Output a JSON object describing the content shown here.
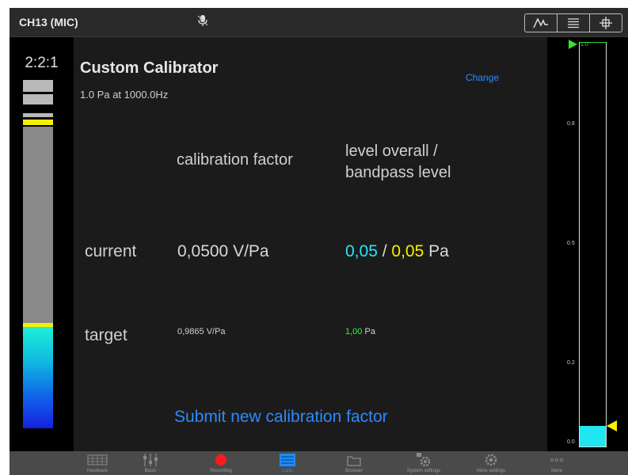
{
  "header": {
    "channel_title": "CH13 (MIC)",
    "mic_icon": "microphone-muted-icon",
    "view_toggle": [
      "waveform-icon",
      "list-icon",
      "crosshair-icon"
    ]
  },
  "left_meter": {
    "ratio": "2:2:1",
    "level_fraction": 0.34,
    "marker_fraction": 0.34
  },
  "calibrator": {
    "title": "Custom Calibrator",
    "subtitle": "1.0 Pa at 1000.0Hz",
    "change_label": "Change",
    "col_factor_header": "calibration factor",
    "col_level_header_line1": "level overall /",
    "col_level_header_line2": "bandpass level",
    "current_label": "current",
    "current_factor": "0,0500 V/Pa",
    "current_overall": "0,05",
    "current_sep": " / ",
    "current_bandpass": "0,05",
    "current_unit": " Pa",
    "target_label": "target",
    "target_factor": "0,9865 V/Pa",
    "target_level_value": "1,00",
    "target_level_unit": " Pa",
    "submit_label": "Submit new calibration factor"
  },
  "right_scale": {
    "ticks": [
      {
        "label": "1.0",
        "value": 1.0
      },
      {
        "label": "0.8",
        "value": 0.8
      },
      {
        "label": "0.5",
        "value": 0.5
      },
      {
        "label": "0.2",
        "value": 0.2
      },
      {
        "label": "0.0",
        "value": 0.0
      }
    ],
    "fill_value": 0.05
  },
  "toolbar": {
    "items": [
      {
        "label": "Hardware",
        "icon": "hardware-grid-icon",
        "active": false
      },
      {
        "label": "Basic",
        "icon": "faders-icon",
        "active": false
      },
      {
        "label": "Recording",
        "icon": "record-icon",
        "active": false
      },
      {
        "label": "Calib.",
        "icon": "calibration-icon",
        "active": true
      },
      {
        "label": "Browser",
        "icon": "browser-icon",
        "active": false
      },
      {
        "label": "System settings",
        "icon": "system-settings-icon",
        "active": false
      },
      {
        "label": "More settings",
        "icon": "settings-gear-icon",
        "active": false
      },
      {
        "label": "More",
        "icon": "more-dots-icon",
        "active": false
      }
    ]
  },
  "colors": {
    "accent_blue": "#2a8aff",
    "cyan_level": "#23e8f5",
    "yellow_level": "#f5f000",
    "green_target": "#2df046"
  }
}
